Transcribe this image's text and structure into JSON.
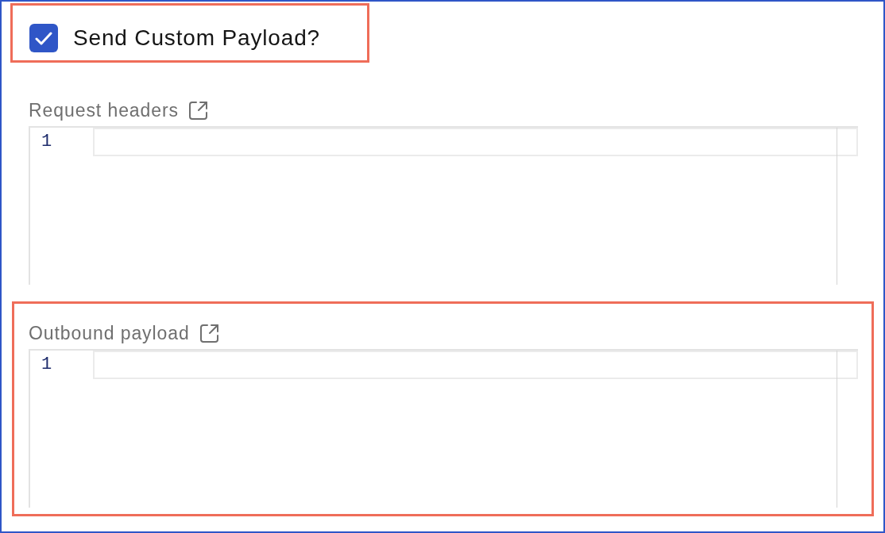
{
  "checkbox": {
    "label": "Send Custom Payload?",
    "checked": true,
    "highlighted": true
  },
  "editors": [
    {
      "label": "Request headers",
      "lines": [
        {
          "number": "1",
          "current": true
        }
      ],
      "highlighted": false
    },
    {
      "label": "Outbound payload",
      "lines": [
        {
          "number": "1",
          "current": true
        }
      ],
      "highlighted": true
    }
  ]
}
